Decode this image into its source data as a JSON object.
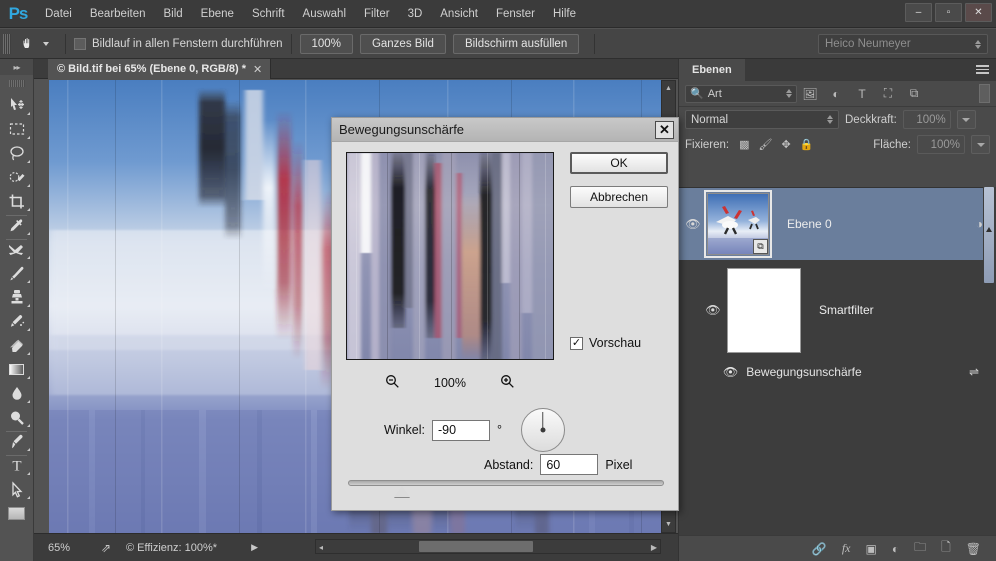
{
  "app": {
    "logo": "Ps",
    "menu_items": [
      "Datei",
      "Bearbeiten",
      "Bild",
      "Ebene",
      "Schrift",
      "Auswahl",
      "Filter",
      "3D",
      "Ansicht",
      "Fenster",
      "Hilfe"
    ],
    "window_buttons": {
      "minimize": "–",
      "maximize": "▫",
      "close": "✕"
    }
  },
  "options_bar": {
    "tool_icon": "hand-tool-icon",
    "checkbox_label": "Bildlauf in allen Fenstern durchführen",
    "checkbox_checked": false,
    "buttons": [
      "100%",
      "Ganzes Bild",
      "Bildschirm ausfüllen"
    ],
    "workspace": "Heico Neumeyer"
  },
  "toolbar": {
    "collapse_label": "▸▸",
    "tools": [
      {
        "name": "move-tool",
        "icon": "↖"
      },
      {
        "name": "marquee-tool",
        "icon": "▭"
      },
      {
        "name": "lasso-tool",
        "icon": "⬭"
      },
      {
        "name": "quick-selection-tool",
        "icon": "❂"
      },
      {
        "name": "crop-tool",
        "icon": "⌗"
      },
      {
        "name": "eyedropper-tool",
        "icon": "✒"
      },
      {
        "name": "healing-brush-tool",
        "icon": "✂"
      },
      {
        "name": "brush-tool",
        "icon": "✎"
      },
      {
        "name": "clone-stamp-tool",
        "icon": "⚑"
      },
      {
        "name": "history-brush-tool",
        "icon": "☙"
      },
      {
        "name": "eraser-tool",
        "icon": "▱"
      },
      {
        "name": "gradient-tool",
        "icon": "▤"
      },
      {
        "name": "blur-tool",
        "icon": "●"
      },
      {
        "name": "dodge-tool",
        "icon": "⚲"
      },
      {
        "name": "pen-tool",
        "icon": "✒"
      },
      {
        "name": "type-tool",
        "icon": "T"
      },
      {
        "name": "path-selection-tool",
        "icon": "➤"
      }
    ]
  },
  "document": {
    "tab_title": "© Bild.tif bei 65% (Ebene 0, RGB/8) *",
    "close_label": "✕",
    "status": {
      "zoom": "65%",
      "share_icon": "share-icon",
      "efficiency": "© Effizienz: 100%*",
      "arrow": "▶",
      "left_arrow": "◂"
    }
  },
  "dialog": {
    "title": "Bewegungsunschärfe",
    "close_label": "✕",
    "ok_label": "OK",
    "cancel_label": "Abbrechen",
    "preview_label": "Vorschau",
    "preview_checked": true,
    "zoom_out_icon": "zoom-out-icon",
    "zoom_in_icon": "zoom-in-icon",
    "zoom_level": "100%",
    "angle_label": "Winkel:",
    "angle_value": "-90",
    "angle_unit": "°",
    "distance_label": "Abstand:",
    "distance_value": "60",
    "distance_unit": "Pixel"
  },
  "panel": {
    "tab_label": "Ebenen",
    "filter": {
      "search_icon": "search-icon",
      "kind_label": "Art",
      "icons": [
        "pixel-filter-icon",
        "adjustment-filter-icon",
        "type-filter-icon",
        "shape-filter-icon",
        "smartobject-filter-icon"
      ]
    },
    "blend_mode": "Normal",
    "opacity_label": "Deckkraft:",
    "opacity_value": "100%",
    "lock_label": "Fixieren:",
    "fill_label": "Fläche:",
    "fill_value": "100%",
    "layers": [
      {
        "name": "Ebene 0",
        "visible": true,
        "selected": true,
        "type": "smart-object"
      },
      {
        "name": "Smartfilter",
        "visible": true,
        "selected": false,
        "type": "smart-filter-group"
      },
      {
        "name": "Bewegungsunschärfe",
        "visible": true,
        "selected": false,
        "type": "smart-filter"
      }
    ],
    "footer_icons": [
      "link-icon",
      "fx-icon",
      "mask-icon",
      "adjustment-icon",
      "group-icon",
      "new-layer-icon",
      "delete-icon"
    ],
    "fx_label": "fx"
  }
}
